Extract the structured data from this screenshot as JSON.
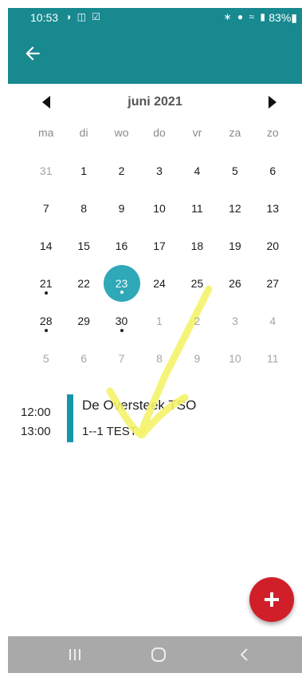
{
  "status_bar": {
    "time": "10:53",
    "left_icons": [
      "notification-icon",
      "shield-icon",
      "checkbox-icon"
    ],
    "right_icons": [
      "bluetooth-icon",
      "location-icon",
      "wifi-icon",
      "signal-icon"
    ],
    "battery": "83%"
  },
  "colors": {
    "primary": "#17898f",
    "selected_day": "#2fa8b8",
    "event_bar": "#1597ab",
    "fab": "#d11f2a",
    "annotation": "#f4f36a"
  },
  "calendar": {
    "month_title": "juni 2021",
    "weekdays": [
      "ma",
      "di",
      "wo",
      "do",
      "vr",
      "za",
      "zo"
    ],
    "days": [
      {
        "label": "31",
        "outside": true
      },
      {
        "label": "1"
      },
      {
        "label": "2"
      },
      {
        "label": "3"
      },
      {
        "label": "4"
      },
      {
        "label": "5"
      },
      {
        "label": "6"
      },
      {
        "label": "7"
      },
      {
        "label": "8"
      },
      {
        "label": "9"
      },
      {
        "label": "10"
      },
      {
        "label": "11"
      },
      {
        "label": "12"
      },
      {
        "label": "13"
      },
      {
        "label": "14"
      },
      {
        "label": "15"
      },
      {
        "label": "16"
      },
      {
        "label": "17"
      },
      {
        "label": "18"
      },
      {
        "label": "19"
      },
      {
        "label": "20"
      },
      {
        "label": "21",
        "dot": true
      },
      {
        "label": "22"
      },
      {
        "label": "23",
        "selected": true,
        "dot": true
      },
      {
        "label": "24"
      },
      {
        "label": "25"
      },
      {
        "label": "26"
      },
      {
        "label": "27"
      },
      {
        "label": "28",
        "dot": true
      },
      {
        "label": "29"
      },
      {
        "label": "30",
        "dot": true
      },
      {
        "label": "1",
        "outside": true
      },
      {
        "label": "2",
        "outside": true
      },
      {
        "label": "3",
        "outside": true
      },
      {
        "label": "4",
        "outside": true
      },
      {
        "label": "5",
        "outside": true
      },
      {
        "label": "6",
        "outside": true
      },
      {
        "label": "7",
        "outside": true
      },
      {
        "label": "8",
        "outside": true
      },
      {
        "label": "9",
        "outside": true
      },
      {
        "label": "10",
        "outside": true
      },
      {
        "label": "11",
        "outside": true
      }
    ]
  },
  "event": {
    "start_time": "12:00",
    "end_time": "13:00",
    "title": "De Oversteek TSO",
    "subtitle": "1--1 TEST"
  },
  "fab": {
    "icon": "plus-icon"
  },
  "nav_bar": {
    "icons": [
      "recent-apps-icon",
      "home-icon",
      "back-nav-icon"
    ]
  }
}
